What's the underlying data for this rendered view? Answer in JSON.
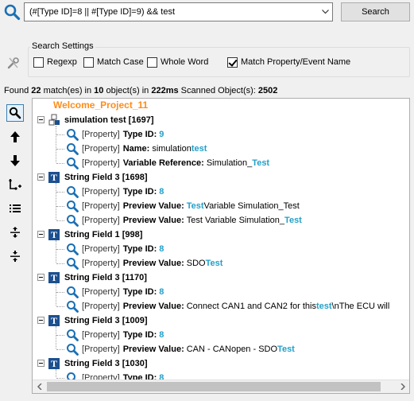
{
  "query": {
    "value": "(#[Type ID]=8 || #[Type ID]=9) && test"
  },
  "search_button": "Search",
  "settings": {
    "title": "Search Settings",
    "options": [
      {
        "label": "Regexp",
        "checked": false
      },
      {
        "label": "Match Case",
        "checked": false
      },
      {
        "label": "Whole Word",
        "checked": false
      },
      {
        "label": "Match Property/Event Name",
        "checked": true
      }
    ]
  },
  "status": {
    "found_prefix": "Found",
    "matches": "22",
    "matches_text": "match(es) in",
    "objects": "10",
    "objects_text": "object(s) in",
    "time": "222ms",
    "scanned_text": "Scanned Object(s):",
    "scanned": "2502"
  },
  "toolbar": [
    "search-tool",
    "arrow-up",
    "arrow-down",
    "add-branch",
    "list",
    "expand-all",
    "collapse-all"
  ],
  "tree": {
    "project": "Welcome_Project_11",
    "objects": [
      {
        "label": "simulation test [1697]",
        "icon": "signal-icon",
        "props": [
          {
            "tag": "[Property]",
            "name": "Type ID:",
            "pre": "",
            "hl": "9",
            "post": ""
          },
          {
            "tag": "[Property]",
            "name": "Name:",
            "pre": "simulation ",
            "hl": "test",
            "post": ""
          },
          {
            "tag": "[Property]",
            "name": "Variable Reference:",
            "pre": "Simulation_",
            "hl": "Test",
            "post": ""
          }
        ]
      },
      {
        "label": "String Field 3 [1698]",
        "icon": "text-field-icon",
        "props": [
          {
            "tag": "[Property]",
            "name": "Type ID:",
            "pre": "",
            "hl": "8",
            "post": ""
          },
          {
            "tag": "[Property]",
            "name": "Preview Value:",
            "pre": "",
            "hl": "Test",
            "post": " Variable Simulation_Test"
          },
          {
            "tag": "[Property]",
            "name": "Preview Value:",
            "pre": "Test Variable Simulation_",
            "hl": "Test",
            "post": ""
          }
        ]
      },
      {
        "label": "String Field 1 [998]",
        "icon": "text-field-icon",
        "props": [
          {
            "tag": "[Property]",
            "name": "Type ID:",
            "pre": "",
            "hl": "8",
            "post": ""
          },
          {
            "tag": "[Property]",
            "name": "Preview Value:",
            "pre": "SDO ",
            "hl": "Test",
            "post": ""
          }
        ]
      },
      {
        "label": "String Field 3 [1170]",
        "icon": "text-field-icon",
        "props": [
          {
            "tag": "[Property]",
            "name": "Type ID:",
            "pre": "",
            "hl": "8",
            "post": ""
          },
          {
            "tag": "[Property]",
            "name": "Preview Value:",
            "pre": "Connect CAN1 and CAN2 for this ",
            "hl": "test",
            "post": "\\nThe ECU will"
          }
        ]
      },
      {
        "label": "String Field 3 [1009]",
        "icon": "text-field-icon",
        "props": [
          {
            "tag": "[Property]",
            "name": "Type ID:",
            "pre": "",
            "hl": "8",
            "post": ""
          },
          {
            "tag": "[Property]",
            "name": "Preview Value:",
            "pre": "CAN - CANopen - SDO ",
            "hl": "Test",
            "post": ""
          }
        ]
      },
      {
        "label": "String Field 3 [1030]",
        "icon": "text-field-icon",
        "props": [
          {
            "tag": "[Property]",
            "name": "Type ID:",
            "pre": "",
            "hl": "8",
            "post": ""
          }
        ]
      }
    ]
  },
  "colors": {
    "highlight": "#23a0c8",
    "project": "#ff8c1a",
    "icon_blue": "#1c4f8f"
  }
}
